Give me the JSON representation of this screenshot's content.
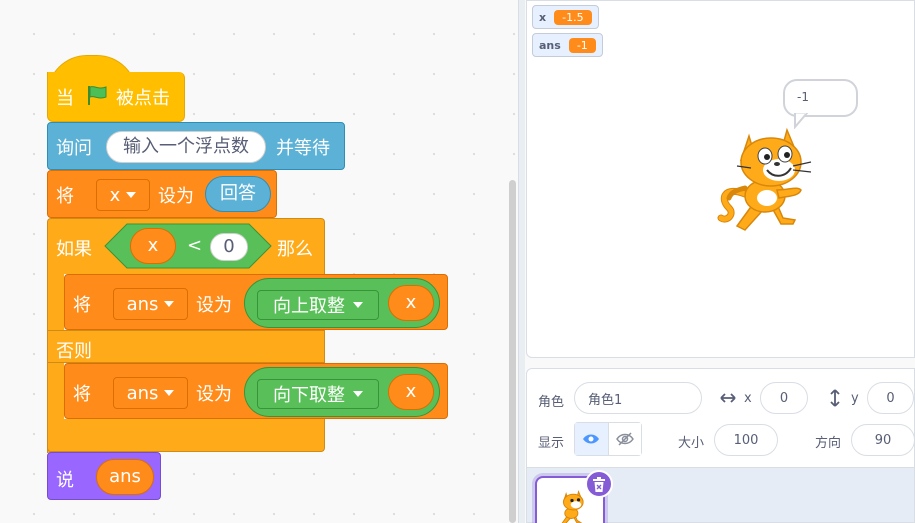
{
  "code": {
    "hat": {
      "when": "当",
      "clicked": "被点击"
    },
    "ask": {
      "label": "询问",
      "question": "输入一个浮点数",
      "wait": "并等待"
    },
    "set_x": {
      "label": "将",
      "var": "x",
      "to": "设为",
      "value": "回答"
    },
    "if_block": {
      "if_label": "如果",
      "then_label": "那么",
      "else_label": "否则",
      "left": "x",
      "op": "<",
      "right": "0"
    },
    "set_ceil": {
      "label": "将",
      "var": "ans",
      "to": "设为",
      "func": "向上取整",
      "arg": "x"
    },
    "set_floor": {
      "label": "将",
      "var": "ans",
      "to": "设为",
      "func": "向下取整",
      "arg": "x"
    },
    "say": {
      "label": "说",
      "value": "ans"
    }
  },
  "stage": {
    "monitors": [
      {
        "name": "x",
        "value": "-1.5"
      },
      {
        "name": "ans",
        "value": "-1"
      }
    ],
    "speech": "-1"
  },
  "sprite_info": {
    "sprite_label": "角色",
    "sprite_name": "角色1",
    "x_label": "x",
    "x_value": "0",
    "y_label": "y",
    "y_value": "0",
    "show_label": "显示",
    "size_label": "大小",
    "size_value": "100",
    "direction_label": "方向",
    "direction_value": "90"
  },
  "colors": {
    "events": "#ffbf00",
    "sensing": "#5cb1d6",
    "variables": "#ff8c1a",
    "control": "#ffab19",
    "operators": "#59c059",
    "looks": "#9966ff",
    "selected": "#855cd6"
  },
  "icons": [
    "green-flag-icon",
    "dropdown-caret-icon",
    "x-arrows-icon",
    "y-arrows-icon",
    "eye-icon",
    "eye-hidden-icon",
    "trash-icon",
    "cat-sprite"
  ]
}
